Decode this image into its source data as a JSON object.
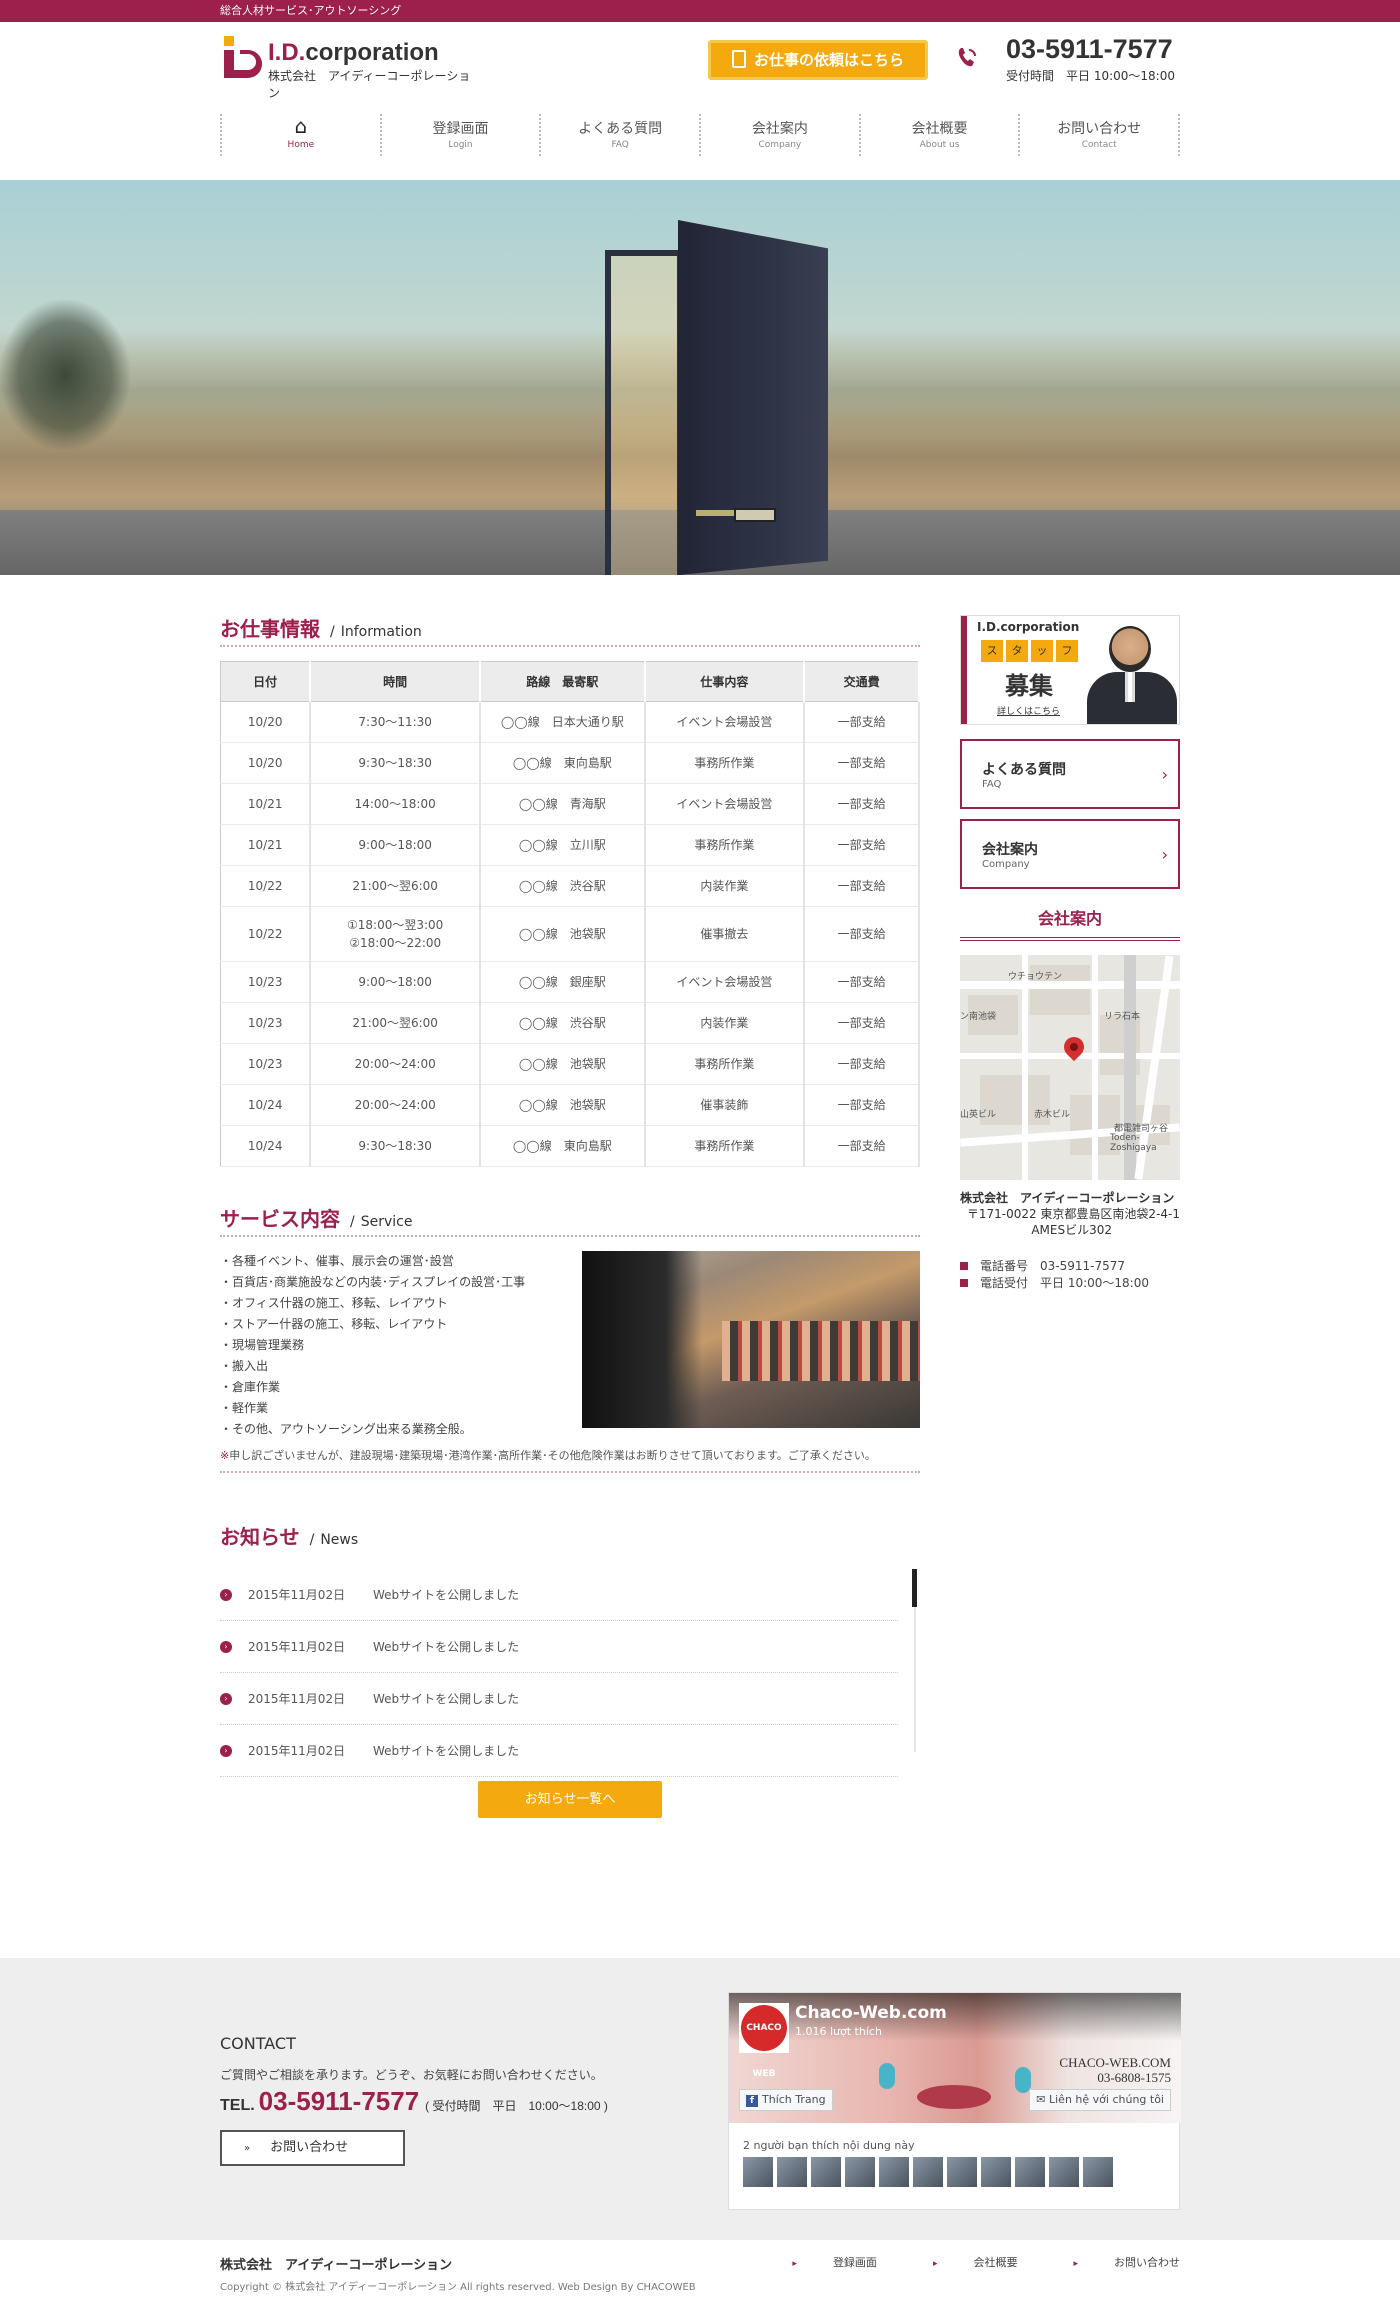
{
  "topbar": {
    "text": "総合人材サービス･アウトソーシング"
  },
  "header": {
    "logo_title_a": "I.D.",
    "logo_title_b": "corporation",
    "logo_sub": "株式会社　アイディーコーポレーション",
    "request_button": "お仕事の依頼はこちら",
    "tel": "03-5911-7577",
    "hours": "受付時間　平日 10:00～18:00"
  },
  "nav": [
    {
      "jp": "⌂",
      "en": "Home"
    },
    {
      "jp": "登録画面",
      "en": "Login"
    },
    {
      "jp": "よくある質問",
      "en": "FAQ"
    },
    {
      "jp": "会社案内",
      "en": "Company"
    },
    {
      "jp": "会社概要",
      "en": "About us"
    },
    {
      "jp": "お問い合わせ",
      "en": "Contact"
    }
  ],
  "info": {
    "title_jp": "お仕事情報",
    "sep": "/",
    "title_en": "Information",
    "headers": [
      "日付",
      "時間",
      "路線　最寄駅",
      "仕事内容",
      "交通費"
    ],
    "rows": [
      [
        "10/20",
        "7:30～11:30",
        "◯◯線　日本大通り駅",
        "イベント会場設営",
        "一部支給"
      ],
      [
        "10/20",
        "9:30～18:30",
        "◯◯線　東向島駅",
        "事務所作業",
        "一部支給"
      ],
      [
        "10/21",
        "14:00～18:00",
        "◯◯線　青海駅",
        "イベント会場設営",
        "一部支給"
      ],
      [
        "10/21",
        "9:00～18:00",
        "◯◯線　立川駅",
        "事務所作業",
        "一部支給"
      ],
      [
        "10/22",
        "21:00～翌6:00",
        "◯◯線　渋谷駅",
        "内装作業",
        "一部支給"
      ],
      [
        "10/22",
        "①18:00～翌3:00\n②18:00～22:00",
        "◯◯線　池袋駅",
        "催事撤去",
        "一部支給"
      ],
      [
        "10/23",
        "9:00～18:00",
        "◯◯線　銀座駅",
        "イベント会場設営",
        "一部支給"
      ],
      [
        "10/23",
        "21:00～翌6:00",
        "◯◯線　渋谷駅",
        "内装作業",
        "一部支給"
      ],
      [
        "10/23",
        "20:00～24:00",
        "◯◯線　池袋駅",
        "事務所作業",
        "一部支給"
      ],
      [
        "10/24",
        "20:00～24:00",
        "◯◯線　池袋駅",
        "催事装飾",
        "一部支給"
      ],
      [
        "10/24",
        "9:30～18:30",
        "◯◯線　東向島駅",
        "事務所作業",
        "一部支給"
      ]
    ]
  },
  "service": {
    "title_jp": "サービス内容",
    "sep": "/",
    "title_en": "Service",
    "items": [
      "・各種イベント、催事、展示会の運営･設営",
      "・百貨店･商業施設などの内装･ディスプレイの設営･工事",
      "・オフィス什器の施工、移転、レイアウト",
      "・ストアー什器の施工、移転、レイアウト",
      "・現場管理業務",
      "・搬入出",
      "・倉庫作業",
      "・軽作業",
      "・その他、アウトソーシング出来る業務全般。"
    ],
    "note_mark": "※",
    "note": "申し訳ございませんが、建設現場･建築現場･港湾作業･高所作業･その他危険作業はお断りさせて頂いております。ご了承ください。"
  },
  "news": {
    "title_jp": "お知らせ",
    "sep": "/",
    "title_en": "News",
    "items": [
      {
        "date": "2015年11月02日",
        "text": "Webサイトを公開しました"
      },
      {
        "date": "2015年11月02日",
        "text": "Webサイトを公開しました"
      },
      {
        "date": "2015年11月02日",
        "text": "Webサイトを公開しました"
      },
      {
        "date": "2015年11月02日",
        "text": "Webサイトを公開しました"
      }
    ],
    "more": "お知らせ一覧へ"
  },
  "sidebar": {
    "recruit": {
      "brand": "I.D.corporation",
      "staff": [
        "ス",
        "タ",
        "ッ",
        "フ"
      ],
      "boshu": "募集",
      "link": "詳しくはこちら"
    },
    "faq": {
      "jp": "よくある質問",
      "en": "FAQ"
    },
    "company": {
      "jp": "会社案内",
      "en": "Company"
    },
    "arrow": "›",
    "company_title": "会社案内",
    "map_labels": [
      "ウチョウテン",
      "ン南池袋",
      "リラ石本",
      "山英ビル",
      "赤木ビル",
      "都電雑司ヶ谷",
      "Toden-Zoshigaya"
    ],
    "name": "株式会社　アイディーコーポレーション",
    "addr1": "〒171-0022 東京都豊島区南池袋2-4-1",
    "addr2": "AMESビル302",
    "tel": "電話番号　03-5911-7577",
    "hours": "電話受付　平日 10:00～18:00"
  },
  "contact": {
    "title": "CONTACT",
    "msg": "ご質問やご相談を承ります。どうぞ、お気軽にお問い合わせください。",
    "tel_label": "TEL.",
    "tel": "03-5911-7577",
    "hours": "( 受付時間　平日　10:00～18:00 )",
    "button_arrow": "»",
    "button": "お問い合わせ"
  },
  "facebook": {
    "logo": "CHACO WEB",
    "page": "Chaco-Web.com",
    "likes": "1.016 lượt thích",
    "brand1": "CHACO-WEB.COM",
    "brand2": "03-6808-1575",
    "like_btn": "Thích Trang",
    "contact_btn": "Liên hệ với chúng tôi",
    "friends": "2 người bạn thích nội dung này"
  },
  "footer": {
    "company": "株式会社　アイディーコーポレーション",
    "copyright": "Copyright © 株式会社 アイディーコーポレーション All rights reserved. Web Design By CHACOWEB",
    "arrow": "▸",
    "links": [
      "登録画面",
      "会社概要",
      "お問い合わせ"
    ]
  },
  "colors": {
    "brand": "#9c1f4c",
    "accent": "#f4a90f"
  },
  "icons": [
    "home-icon",
    "phone-icon",
    "document-icon",
    "chevron-right-icon",
    "map-pin-icon",
    "facebook-icon"
  ]
}
